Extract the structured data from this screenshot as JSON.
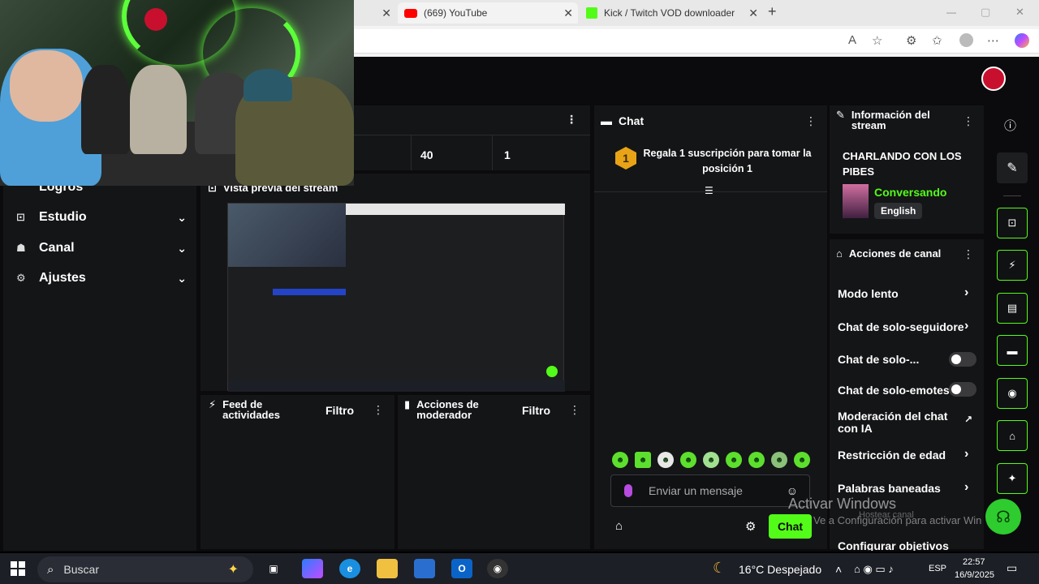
{
  "browser": {
    "tabs": [
      {
        "label": "(669) YouTube"
      },
      {
        "label": "Kick / Twitch VOD downloader"
      }
    ],
    "new_tab": "+",
    "window_controls": {
      "min": "—",
      "max": "▢",
      "close": "✕"
    }
  },
  "sidebar": {
    "items": [
      {
        "label": "Logros"
      },
      {
        "label": "Estudio"
      },
      {
        "label": "Canal"
      },
      {
        "label": "Ajustes"
      }
    ]
  },
  "stats": {
    "values": [
      "40",
      "1"
    ]
  },
  "preview": {
    "title": "Vista previa del stream"
  },
  "feed": {
    "title": "Feed de actividades",
    "filter": "Filtro"
  },
  "modactions": {
    "title": "Acciones de moderador",
    "filter": "Filtro"
  },
  "chat": {
    "title": "Chat",
    "pinned_rank": "1",
    "pinned_text": "Regala 1 suscripción para tomar la posición 1",
    "input_placeholder": "Enviar un mensaje",
    "send_button": "Chat"
  },
  "streaminfo": {
    "title": "Información del stream",
    "stream_title": "CHARLANDO CON LOS PIBES",
    "category": "Conversando",
    "language": "English"
  },
  "channelactions": {
    "title": "Acciones de canal",
    "items": [
      {
        "label": "Modo lento"
      },
      {
        "label": "Chat de solo-seguidore"
      },
      {
        "label": "Chat de solo-..."
      },
      {
        "label": "Chat de solo-emotes"
      },
      {
        "label": "Moderación del chat con IA"
      },
      {
        "label": "Restricción de edad"
      },
      {
        "label": "Palabras baneadas"
      },
      {
        "label": "Configurar objetivos"
      }
    ]
  },
  "watermark": {
    "line1": "Activar Windows",
    "line2": "Ve a Configuración para activar Windows.",
    "overlay": "Hostear canal"
  },
  "taskbar": {
    "search": "Buscar",
    "weather": "16°C  Despejado",
    "lang": "ESP",
    "time": "22:57",
    "date": "16/9/2025"
  },
  "colors": {
    "accent": "#53fc18",
    "panel": "#141517",
    "background": "#0b0b0d"
  }
}
